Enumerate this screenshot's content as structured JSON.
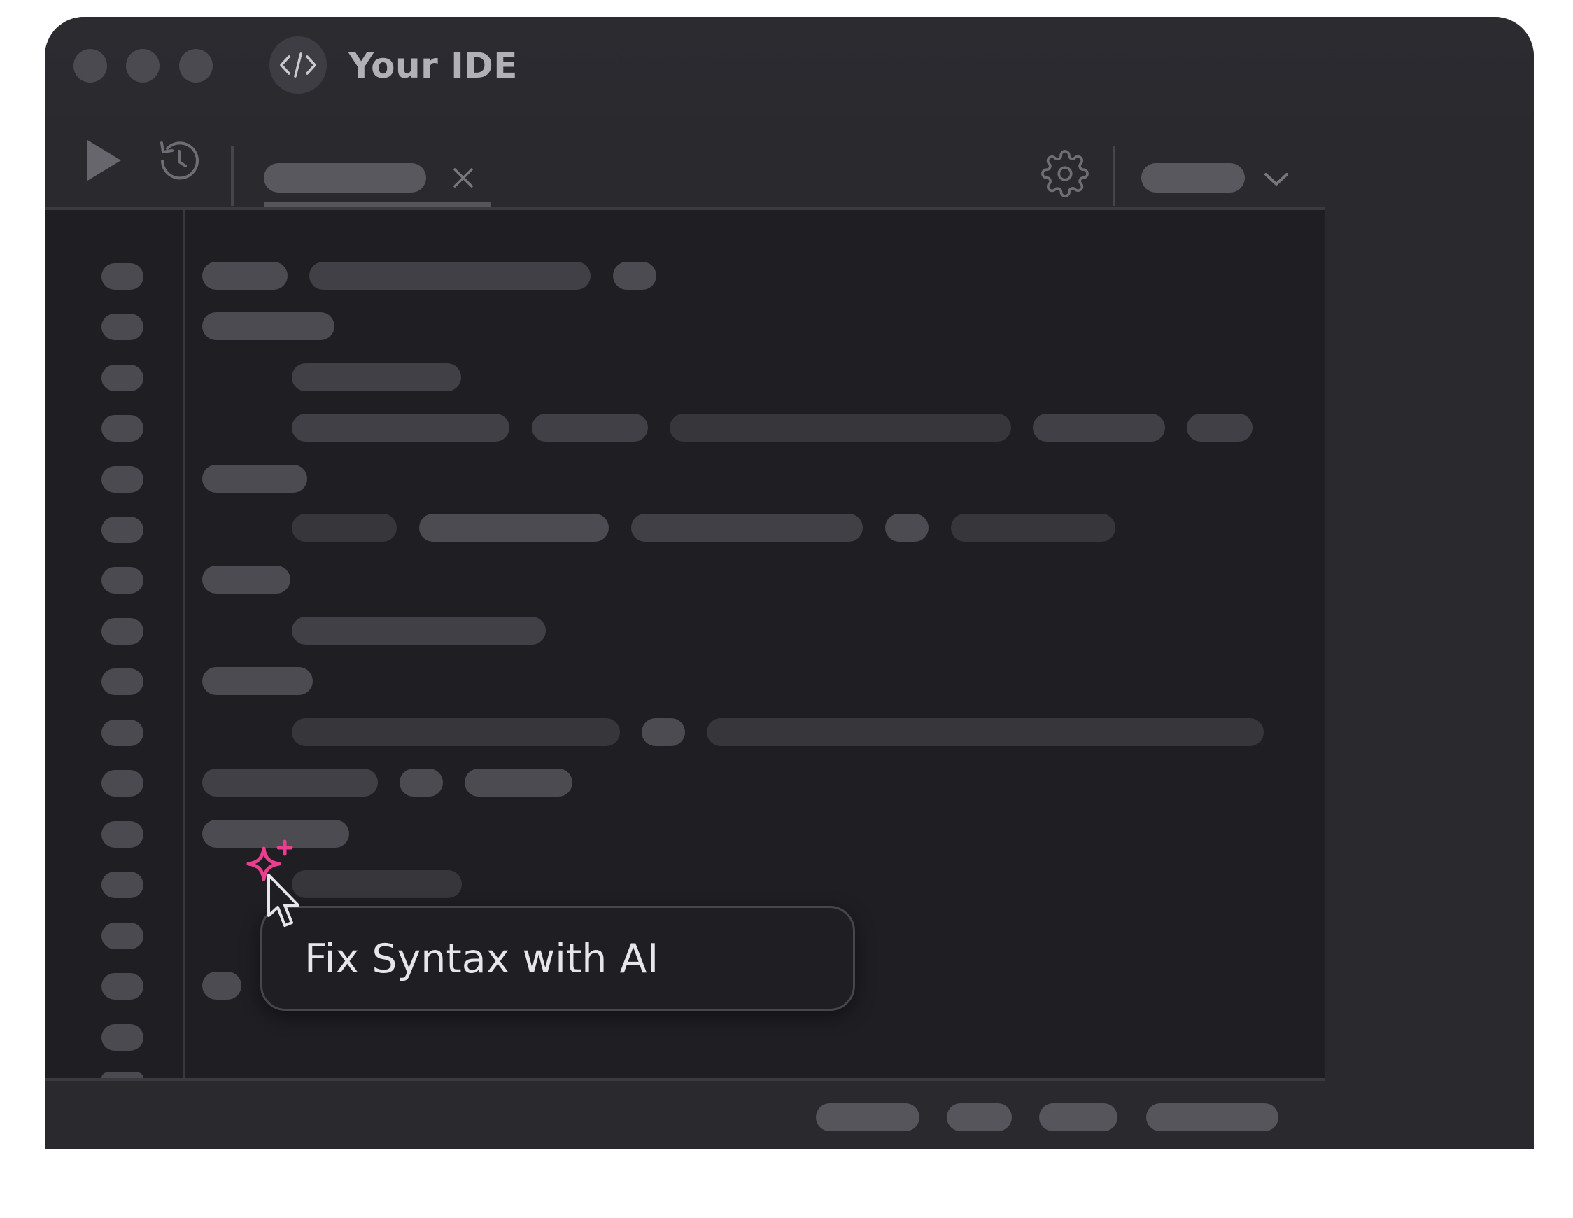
{
  "window": {
    "title": "Your IDE",
    "traffic_lights": [
      "close",
      "minimize",
      "maximize"
    ]
  },
  "toolbar": {
    "icons": [
      "play-icon",
      "history-icon",
      "close-icon",
      "gear-icon",
      "chevron-down-icon"
    ]
  },
  "ai_action": {
    "label": "Fix Syntax with AI",
    "icon": "sparkle-plus-icon",
    "accent_color": "#ec3e8f"
  },
  "colors": {
    "window_bg": "#29292e",
    "editor_bg": "#1f1f23",
    "placeholder": "#4b4b51",
    "accent": "#ec3e8f"
  }
}
